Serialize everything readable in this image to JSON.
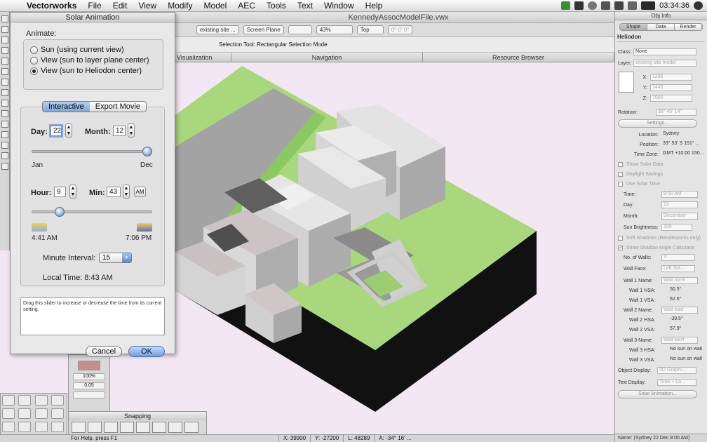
{
  "menubar": {
    "app": "Vectorworks",
    "items": [
      "File",
      "Edit",
      "View",
      "Modify",
      "Model",
      "AEC",
      "Tools",
      "Text",
      "Window",
      "Help"
    ],
    "clock": "03:34:36",
    "colors": {
      "bg": "#e6e6e6"
    }
  },
  "document": {
    "title": "KennedyAssocModelFile.vwx"
  },
  "toolbar": {
    "layer": "existing site ...",
    "plane": "Screen Plane",
    "zoom": "43%",
    "view": "Top",
    "rotation": "0° 0' 0\""
  },
  "mode_bar": {
    "text": "Selection Tool: Rectangular Selection Mode"
  },
  "palettes": {
    "visualization": "Visualization",
    "navigation": "Navigation",
    "resource_browser": "Resource Browser"
  },
  "dialog": {
    "title": "Solar Animation",
    "animate_label": "Animate:",
    "options": [
      {
        "label": "Sun (using current view)",
        "selected": false
      },
      {
        "label": "View (sun to layer plane center)",
        "selected": false
      },
      {
        "label": "View (sun to Heliodon center)",
        "selected": true
      }
    ],
    "tabs": [
      {
        "label": "Interactive",
        "selected": true
      },
      {
        "label": "Export Movie",
        "selected": false
      }
    ],
    "day_label": "Day:",
    "day_value": "22",
    "month_label": "Month:",
    "month_value": "12",
    "month_slider_min": "Jan",
    "month_slider_max": "Dec",
    "month_slider_position": 0.96,
    "hour_label": "Hour:",
    "hour_value": "9",
    "min_label": "Min:",
    "min_value": "43",
    "ampm": "AM",
    "sunrise": "4:41 AM",
    "sunset": "7:06 PM",
    "time_slider_position": 0.23,
    "interval_label": "Minute Interval:",
    "interval_value": "15",
    "local_time": "Local Time: 8:43 AM",
    "help_text": "Drag this slider to increase or decrease the time from its current setting.",
    "cancel": "Cancel",
    "ok": "OK"
  },
  "attributes": {
    "opacity": "100%",
    "thickness": "0.05"
  },
  "snapping": {
    "title": "Snapping"
  },
  "status": {
    "help": "For Help, press F1",
    "x": "X:  39900",
    "y": "Y:  -27200",
    "l": "L:  48289",
    "a": "A:  -34° 16' ..."
  },
  "obj_info": {
    "title": "Obj Info",
    "tabs": [
      "Shape",
      "Data",
      "Render"
    ],
    "object": "Heliodon",
    "class_label": "Class:",
    "class_value": "None",
    "layer_label": "Layer:",
    "layer_value": "existing site model",
    "x_label": "X:",
    "x_value": "1295",
    "y_label": "Y:",
    "y_value": "1443",
    "z_label": "Z:",
    "z_value": "7000",
    "rotation_label": "Rotation:",
    "rotation_value": "35° 45' 14\"",
    "settings": "Settings...",
    "location_label": "Location:",
    "location_value": "Sydney",
    "position_label": "Position:",
    "position_value": "33° 53' S  151° ...",
    "timezone_label": "Time Zone:",
    "timezone_value": "GMT +10:00 150...",
    "show_solar_data": "Show Solar Data",
    "daylight_savings": "Daylight Savings",
    "use_solar_time": "Use Solar Time",
    "time_label": "Time:",
    "time_value": "9:00 AM",
    "day_label": "Day:",
    "day_value": "22",
    "month_label": "Month:",
    "month_value": "December",
    "brightness_label": "Sun Brightness:",
    "brightness_value": "100",
    "soft_shadows": "Soft Shadows (Renderworks only)",
    "shadow_angle": "Show Shadow Angle Calculator",
    "walls_label": "No. of Walls:",
    "walls_value": "3",
    "wall_face_label": "Wall Face:",
    "wall_face_value": "Left Sid...",
    "wall1_name_label": "Wall 1 Name:",
    "wall1_name": "Wall north",
    "wall1_hsa_label": "Wall 1 HSA:",
    "wall1_hsa": "50.5°",
    "wall1_vsa_label": "Wall 1 VSA:",
    "wall1_vsa": "62.6°",
    "wall2_name_label": "Wall 2 Name:",
    "wall2_name": "Wall east",
    "wall2_hsa_label": "Wall 2 HSA:",
    "wall2_hsa": "-39.5°",
    "wall2_vsa_label": "Wall 2 VSA:",
    "wall2_vsa": "57.9°",
    "wall3_name_label": "Wall 3 Name:",
    "wall3_name": "Wall west",
    "wall3_hsa_label": "Wall 3 HSA:",
    "wall3_hsa": "No sun on wall",
    "wall3_vsa_label": "Wall 3 VSA:",
    "wall3_vsa": "No sun on wall",
    "obj_display_label": "Object Display:",
    "obj_display_value": "2D Graphi...",
    "text_display_label": "Text Display:",
    "text_display_value": "Time + Lo...",
    "solar_animation": "Solar Animation...",
    "footer": "Name: (Sydney 22 Dec 9:00 AM)"
  },
  "colors": {
    "lawn": "#a8d67a",
    "road": "#a7a7a7",
    "building": "#d9d9d9",
    "roof": "#cfc7c8",
    "ground_edge": "#111111",
    "canvas": "#f4e7f4"
  }
}
